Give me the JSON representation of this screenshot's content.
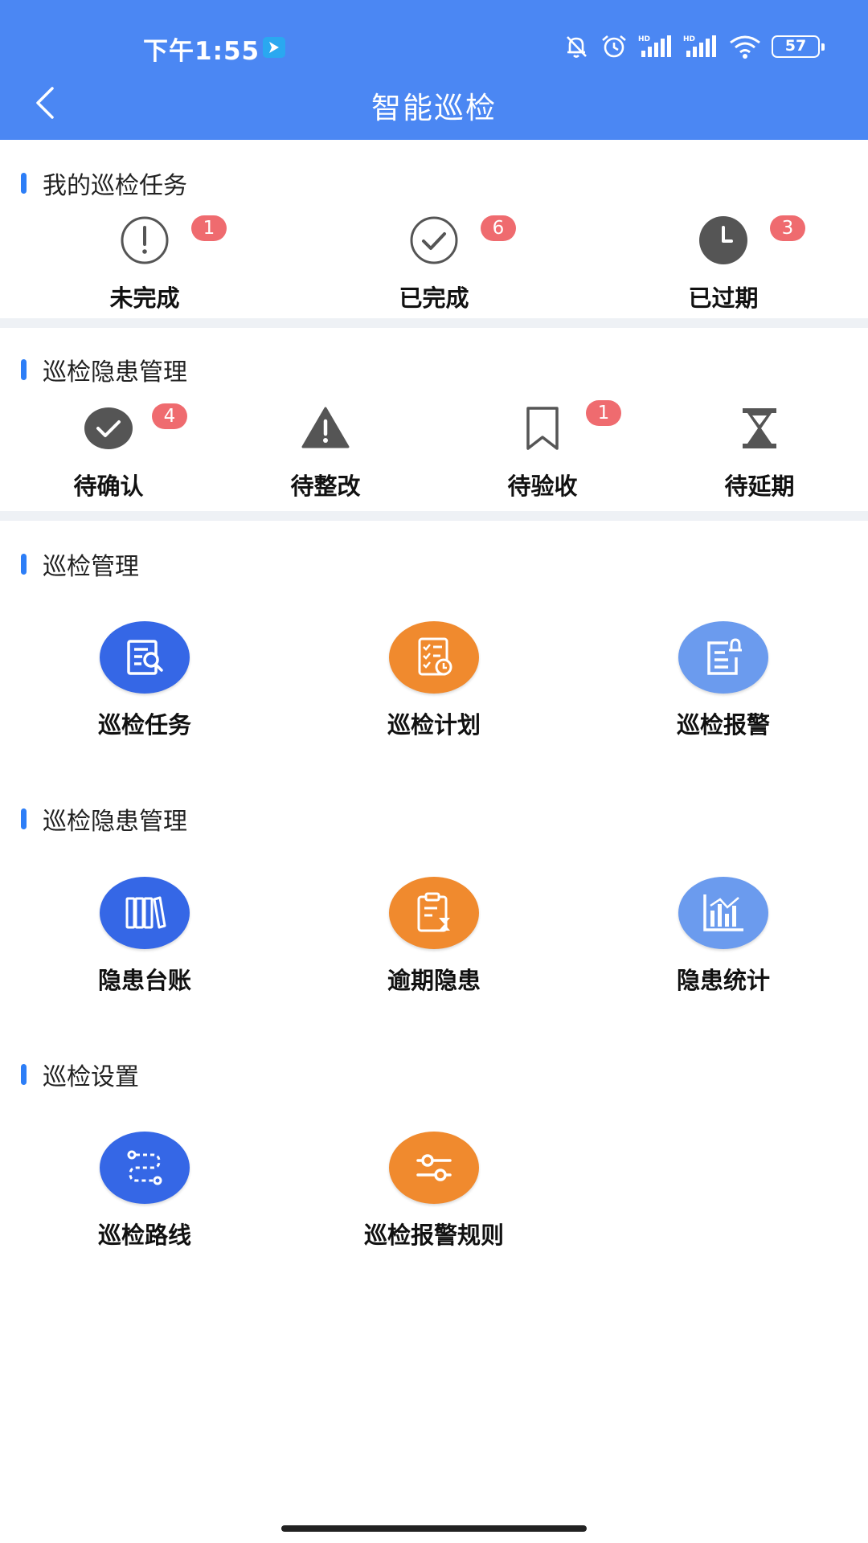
{
  "status_bar": {
    "time": "下午1:55",
    "battery": "57",
    "icons": [
      "mute-bell-icon",
      "alarm-icon",
      "hd-signal-icon",
      "hd-signal-icon",
      "wifi-icon",
      "battery-icon"
    ]
  },
  "header": {
    "title": "智能巡检",
    "back_icon": "chevron-left-icon"
  },
  "my_tasks": {
    "title": "我的巡检任务",
    "items": [
      {
        "label": "未完成",
        "badge": "1",
        "icon": "exclamation-circle-icon"
      },
      {
        "label": "已完成",
        "badge": "6",
        "icon": "check-circle-icon"
      },
      {
        "label": "已过期",
        "badge": "3",
        "icon": "clock-icon"
      }
    ]
  },
  "hazard_status": {
    "title": "巡检隐患管理",
    "items": [
      {
        "label": "待确认",
        "badge": "4",
        "icon": "check-filled-icon"
      },
      {
        "label": "待整改",
        "badge": "",
        "icon": "warning-triangle-icon"
      },
      {
        "label": "待验收",
        "badge": "1",
        "icon": "bookmark-icon"
      },
      {
        "label": "待延期",
        "badge": "",
        "icon": "hourglass-icon"
      }
    ]
  },
  "inspection_management": {
    "title": "巡检管理",
    "items": [
      {
        "label": "巡检任务",
        "icon": "document-search-icon",
        "color": "#3567e6"
      },
      {
        "label": "巡检计划",
        "icon": "checklist-clock-icon",
        "color": "#f08a2e"
      },
      {
        "label": "巡检报警",
        "icon": "document-alarm-icon",
        "color": "#6b9bee"
      }
    ]
  },
  "hazard_management": {
    "title": "巡检隐患管理",
    "items": [
      {
        "label": "隐患台账",
        "icon": "ledger-books-icon",
        "color": "#3567e6"
      },
      {
        "label": "逾期隐患",
        "icon": "clipboard-hourglass-icon",
        "color": "#f08a2e"
      },
      {
        "label": "隐患统计",
        "icon": "bar-chart-icon",
        "color": "#6b9bee"
      }
    ]
  },
  "inspection_settings": {
    "title": "巡检设置",
    "items": [
      {
        "label": "巡检路线",
        "icon": "route-icon",
        "color": "#3567e6"
      },
      {
        "label": "巡检报警规则",
        "icon": "sliders-icon",
        "color": "#f08a2e"
      }
    ]
  }
}
